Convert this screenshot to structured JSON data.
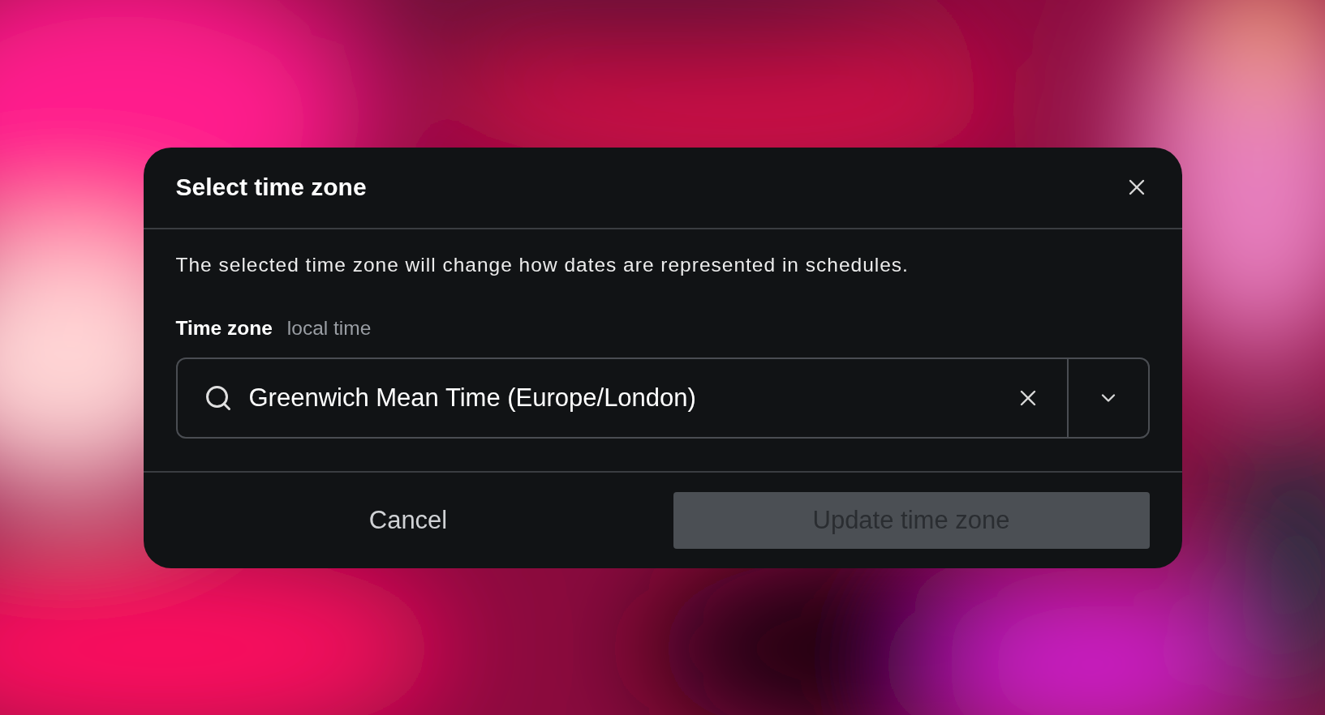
{
  "dialog": {
    "title": "Select time zone",
    "description": "The selected time zone will change how dates are represented in schedules.",
    "field": {
      "label": "Time zone",
      "hint": "local time",
      "value": "Greenwich Mean Time (Europe/London)"
    },
    "buttons": [
      {
        "label": "Cancel",
        "kind": "secondary",
        "disabled": false
      },
      {
        "label": "Update time zone",
        "kind": "primary",
        "disabled": true
      }
    ]
  }
}
